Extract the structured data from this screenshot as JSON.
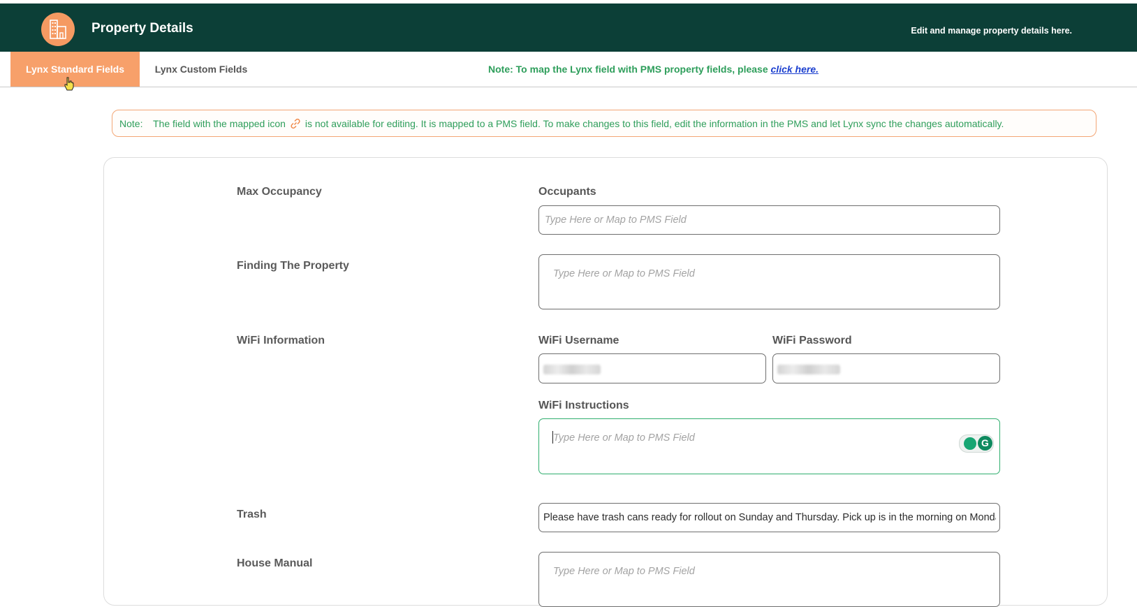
{
  "header": {
    "title": "Property Details",
    "subtitle": "Edit and manage property details here."
  },
  "tabs": [
    {
      "label": "Lynx Standard Fields",
      "active": true
    },
    {
      "label": "Lynx Custom Fields",
      "active": false
    }
  ],
  "tab_note": {
    "text": "Note: To map the Lynx field with PMS property fields, please ",
    "link": "click here."
  },
  "notice": {
    "label": "Note:",
    "text_before": "The field with the mapped icon",
    "text_after": "is not available for editing. It is mapped to a PMS field. To make changes to this field, edit the information in the PMS and let Lynx sync the changes automatically."
  },
  "form": {
    "placeholder": "Type Here or Map to PMS Field",
    "max_occupancy": {
      "label": "Max Occupancy",
      "occupants_label": "Occupants"
    },
    "finding_property": {
      "label": "Finding The Property"
    },
    "wifi": {
      "label": "WiFi Information",
      "username_label": "WiFi Username",
      "password_label": "WiFi Password",
      "instructions_label": "WiFi Instructions"
    },
    "trash": {
      "label": "Trash",
      "value": "Please have trash cans ready for rollout on Sunday and Thursday. Pick up is in the morning on Monday"
    },
    "house_manual": {
      "label": "House Manual"
    }
  },
  "colors": {
    "header_bg": "#0c3f37",
    "accent": "#f7a06a",
    "note_green": "#2e9e5b",
    "link_blue": "#1b3fcf"
  }
}
